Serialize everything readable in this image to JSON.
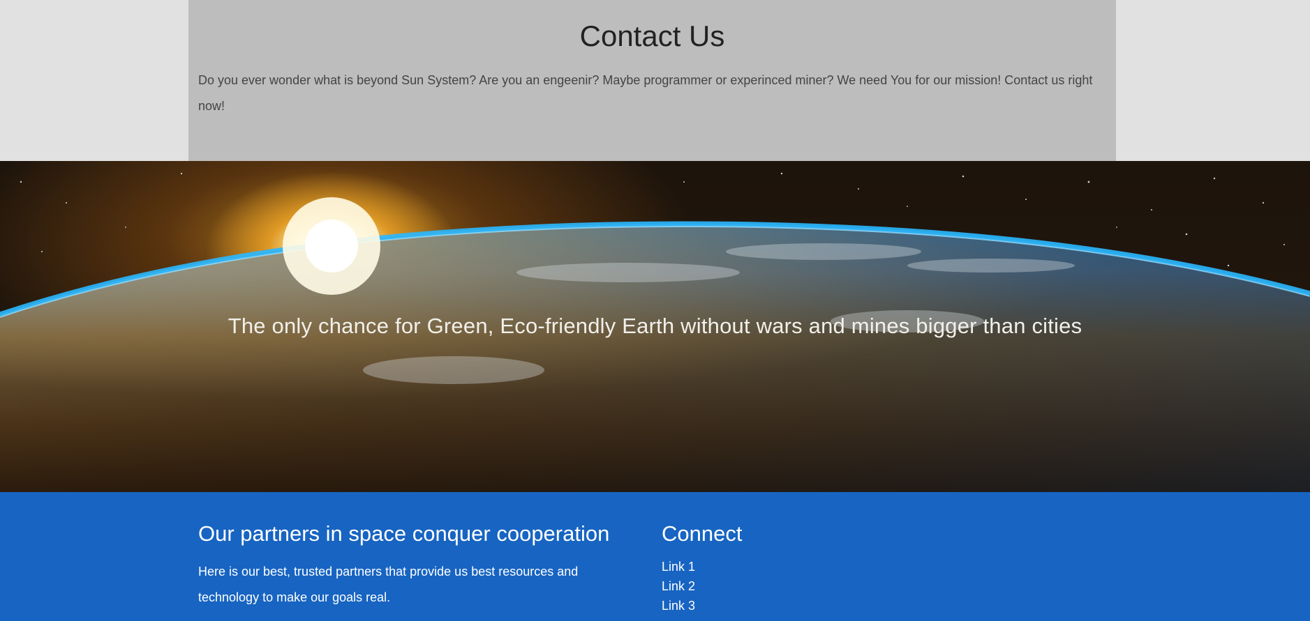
{
  "contact": {
    "title": "Contact Us",
    "text": "Do you ever wonder what is beyond Sun System? Are you an engeenir? Maybe programmer or experinced miner? We need You for our mission! Contact us right now!"
  },
  "hero": {
    "caption": "The only chance for Green, Eco-friendly Earth without wars and mines bigger than cities",
    "image": "earth-from-orbit-with-sunrise"
  },
  "footer": {
    "partners_title": "Our partners in space conquer cooperation",
    "partners_text": "Here is our best, trusted partners that provide us best resources and technology to make our goals real.",
    "connect_title": "Connect",
    "links": [
      {
        "label": "Link 1"
      },
      {
        "label": "Link 2"
      },
      {
        "label": "Link 3"
      }
    ]
  },
  "colors": {
    "page_background": "#e1e1e1",
    "contact_panel": "#bdbdbd",
    "footer_background": "#1764c2"
  }
}
